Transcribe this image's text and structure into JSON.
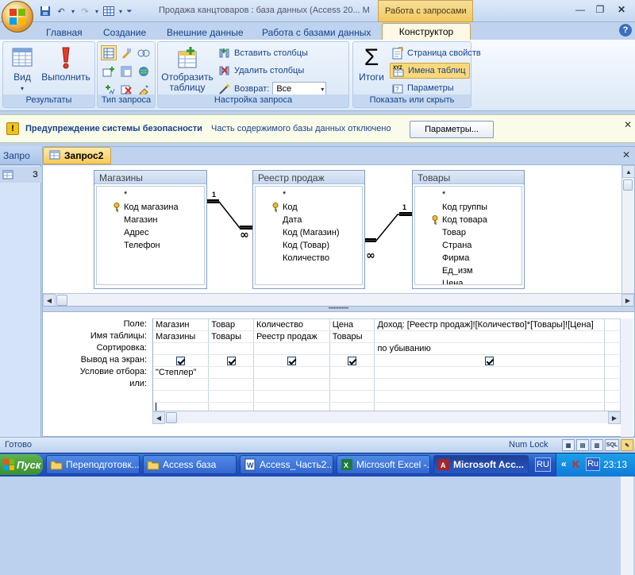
{
  "window": {
    "title": "Продажа канцтоваров : база данных (Access 20... M",
    "context_tab_title": "Работа с запросами"
  },
  "ribbon_tabs": [
    {
      "label": "Главная"
    },
    {
      "label": "Создание"
    },
    {
      "label": "Внешние данные"
    },
    {
      "label": "Работа с базами данных"
    },
    {
      "label": "Конструктор",
      "active": true
    }
  ],
  "help": "?",
  "ribbon": {
    "results": {
      "label": "Результаты",
      "view": "Вид",
      "run": "Выполнить"
    },
    "query_type": {
      "label": "Тип запроса"
    },
    "setup": {
      "label": "Настройка запроса",
      "show_table": "Отобразить таблицу",
      "insert_columns": "Вставить столбцы",
      "delete_columns": "Удалить столбцы",
      "return_label": "Возврат:",
      "return_value": "Все"
    },
    "show_hide": {
      "label": "Показать или скрыть",
      "totals": "Итоги",
      "property_sheet": "Страница свойств",
      "table_names": "Имена таблиц",
      "parameters": "Параметры"
    }
  },
  "security": {
    "title": "Предупреждение системы безопасности",
    "message": "Часть содержимого базы данных отключено",
    "button": "Параметры..."
  },
  "nav": {
    "header": "Запро",
    "item_label": "З"
  },
  "doc_tab": "Запрос2",
  "tables": [
    {
      "name": "Магазины",
      "fields": [
        {
          "name": "*"
        },
        {
          "name": "Код магазина",
          "key": true
        },
        {
          "name": "Магазин"
        },
        {
          "name": "Адрес"
        },
        {
          "name": "Телефон"
        }
      ]
    },
    {
      "name": "Реестр продаж",
      "fields": [
        {
          "name": "*"
        },
        {
          "name": "Код",
          "key": true
        },
        {
          "name": "Дата"
        },
        {
          "name": "Код (Магазин)"
        },
        {
          "name": "Код (Товар)"
        },
        {
          "name": "Количество"
        }
      ]
    },
    {
      "name": "Товары",
      "fields": [
        {
          "name": "*"
        },
        {
          "name": "Код группы"
        },
        {
          "name": "Код товара",
          "key": true
        },
        {
          "name": "Товар"
        },
        {
          "name": "Страна"
        },
        {
          "name": "Фирма"
        },
        {
          "name": "Ед_изм"
        },
        {
          "name": "Цена"
        }
      ]
    }
  ],
  "relations": [
    {
      "one": "1",
      "many": "∞"
    },
    {
      "one": "1",
      "many": "∞"
    }
  ],
  "grid": {
    "row_labels": [
      "Поле:",
      "Имя таблицы:",
      "Сортировка:",
      "Вывод на экран:",
      "Условие отбора:",
      "или:"
    ],
    "columns": [
      {
        "field": "Магазин",
        "table": "Магазины",
        "sort": "",
        "show": true,
        "criteria": "\"Степлер\"",
        "or": ""
      },
      {
        "field": "Товар",
        "table": "Товары",
        "sort": "",
        "show": true,
        "criteria": "",
        "or": ""
      },
      {
        "field": "Количество",
        "table": "Реестр продаж",
        "sort": "",
        "show": true,
        "criteria": "",
        "or": ""
      },
      {
        "field": "Цена",
        "table": "Товары",
        "sort": "",
        "show": true,
        "criteria": "",
        "or": ""
      },
      {
        "field": "Доход: [Реестр продаж]![Количество]*[Товары]![Цена]",
        "table": "",
        "sort": "по убыванию",
        "show": true,
        "criteria": "",
        "or": ""
      }
    ]
  },
  "status": {
    "text": "Готово",
    "numlock": "Num Lock",
    "sql": "SQL"
  },
  "taskbar": {
    "start": "Пуск",
    "items": [
      {
        "label": "Переподготовк..."
      },
      {
        "label": "Access база"
      },
      {
        "label": "Access_Часть2...."
      },
      {
        "label": "Microsoft Excel -..."
      },
      {
        "label": "Microsoft Acc...",
        "active": true
      }
    ],
    "lang": "RU",
    "tray_lang": "Ru",
    "clock": "23:13"
  },
  "colors": {
    "accent": "#15428b",
    "active_tab": "#f8c958"
  }
}
